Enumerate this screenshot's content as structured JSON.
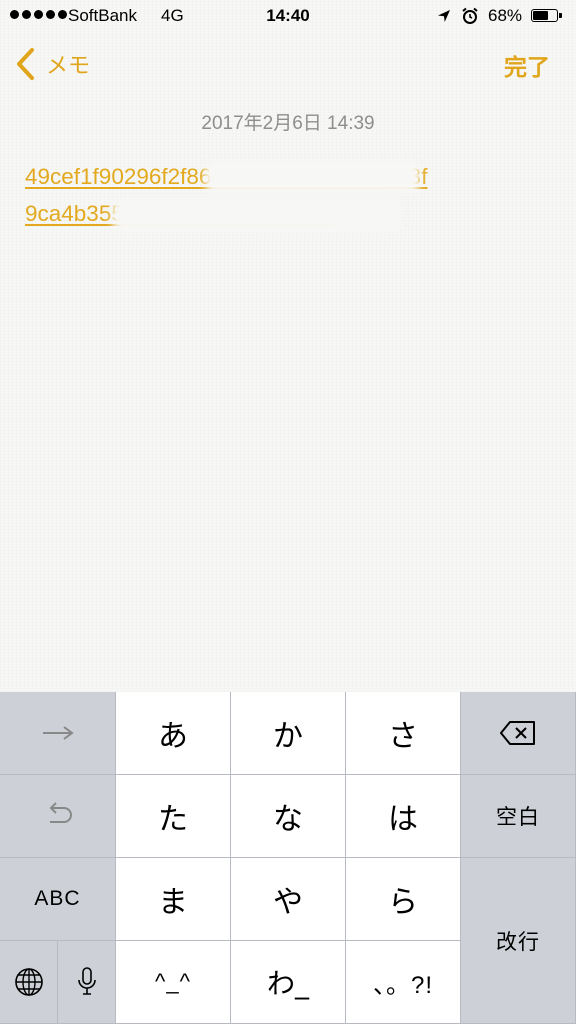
{
  "status_bar": {
    "carrier": "SoftBank",
    "network": "4G",
    "time": "14:40",
    "battery_percent": "68%",
    "battery_level": 0.68,
    "icons": [
      "location-arrow-icon",
      "alarm-clock-icon",
      "battery-icon"
    ]
  },
  "nav": {
    "back_label": "メモ",
    "done_label": "完了"
  },
  "note": {
    "date": "2017年2月6日 14:39",
    "link_line1": "49cef1f90296f2f86ck4603ddd394489ff3f",
    "link_line2": "9ca4b3551c5aa1cefa5f8e32e4"
  },
  "keyboard": {
    "row1": {
      "left_icon": "arrow-right-icon",
      "keys": [
        "あ",
        "か",
        "さ"
      ],
      "right_icon": "delete-backspace-icon"
    },
    "row2": {
      "left_icon": "undo-icon",
      "keys": [
        "た",
        "な",
        "は"
      ],
      "right_label": "空白"
    },
    "row3": {
      "left_label": "ABC",
      "keys": [
        "ま",
        "や",
        "ら"
      ],
      "right_label": "改行"
    },
    "row4": {
      "left_icons": [
        "globe-icon",
        "microphone-icon"
      ],
      "keys": [
        "^_^",
        "わ_",
        "、。?!"
      ]
    }
  },
  "colors": {
    "accent": "#e0a51a",
    "link": "#e3a91f",
    "date_text": "#8e8e8e",
    "keyboard_bg": "#cfd2d8",
    "key_light": "#ffffff"
  }
}
